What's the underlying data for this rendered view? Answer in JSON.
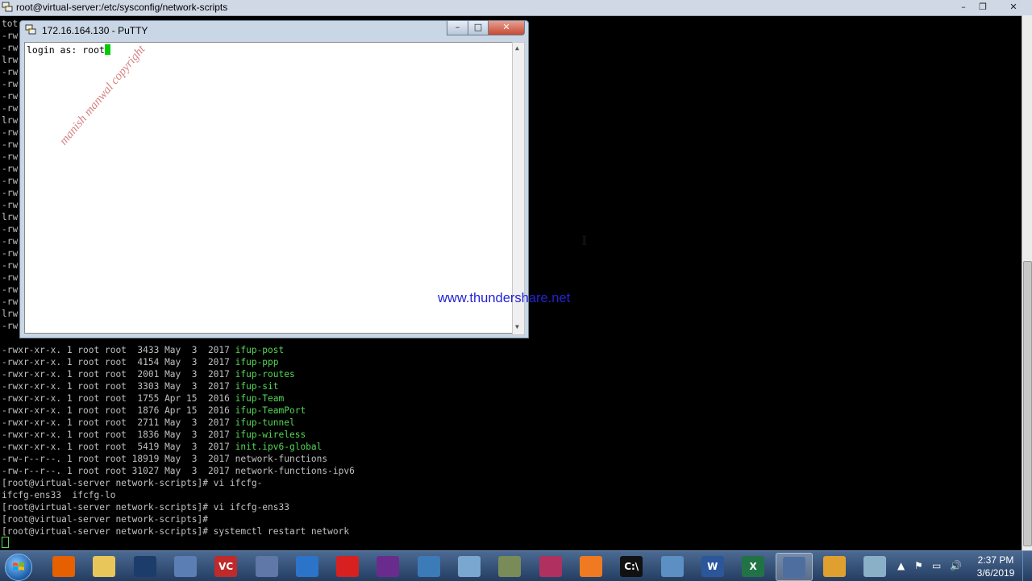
{
  "background_window": {
    "title": "root@virtual-server:/etc/sysconfig/network-scripts",
    "controls": {
      "minimize": "–",
      "maximize": "❐",
      "close": "✕"
    },
    "left_fragments": [
      "tot",
      "-rw",
      "-rw",
      "lrw",
      "-rw",
      "-rw",
      "-rw",
      "-rw",
      "lrw",
      "-rw",
      "-rw",
      "-rw",
      "-rw",
      "-rw",
      "-rw",
      "-rw",
      "lrw",
      "-rw",
      "-rw",
      "-rw",
      "-rw",
      "-rw",
      "-rw",
      "-rw",
      "lrw",
      "-rw"
    ],
    "listing": [
      {
        "info": "-rwxr-xr-x. 1 root root  3433 May  3  2017 ",
        "name": "ifup-post",
        "exec": true
      },
      {
        "info": "-rwxr-xr-x. 1 root root  4154 May  3  2017 ",
        "name": "ifup-ppp",
        "exec": true
      },
      {
        "info": "-rwxr-xr-x. 1 root root  2001 May  3  2017 ",
        "name": "ifup-routes",
        "exec": true
      },
      {
        "info": "-rwxr-xr-x. 1 root root  3303 May  3  2017 ",
        "name": "ifup-sit",
        "exec": true
      },
      {
        "info": "-rwxr-xr-x. 1 root root  1755 Apr 15  2016 ",
        "name": "ifup-Team",
        "exec": true
      },
      {
        "info": "-rwxr-xr-x. 1 root root  1876 Apr 15  2016 ",
        "name": "ifup-TeamPort",
        "exec": true
      },
      {
        "info": "-rwxr-xr-x. 1 root root  2711 May  3  2017 ",
        "name": "ifup-tunnel",
        "exec": true
      },
      {
        "info": "-rwxr-xr-x. 1 root root  1836 May  3  2017 ",
        "name": "ifup-wireless",
        "exec": true
      },
      {
        "info": "-rwxr-xr-x. 1 root root  5419 May  3  2017 ",
        "name": "init.ipv6-global",
        "exec": true
      },
      {
        "info": "-rw-r--r--. 1 root root 18919 May  3  2017 ",
        "name": "network-functions",
        "exec": false
      },
      {
        "info": "-rw-r--r--. 1 root root 31027 May  3  2017 ",
        "name": "network-functions-ipv6",
        "exec": false
      }
    ],
    "commands": [
      "[root@virtual-server network-scripts]# vi ifcfg-",
      "ifcfg-ens33  ifcfg-lo",
      "[root@virtual-server network-scripts]# vi ifcfg-ens33",
      "[root@virtual-server network-scripts]#",
      "[root@virtual-server network-scripts]# systemctl restart network"
    ]
  },
  "putty_window": {
    "title": "172.16.164.130 - PuTTY",
    "controls": {
      "minimize": "–",
      "maximize": "□",
      "close": "✕"
    },
    "terminal_text": "login as: root",
    "watermark": "manish manwal copyright"
  },
  "overlay_url": "www.thundershare.net",
  "mouse_cursor": "I",
  "taskbar": {
    "apps": [
      {
        "name": "firefox",
        "glyph": "",
        "color": "#e66000"
      },
      {
        "name": "file-explorer",
        "glyph": "",
        "color": "#e8c65a"
      },
      {
        "name": "terminal-window",
        "glyph": "",
        "color": "#1c3d6b"
      },
      {
        "name": "network-tool",
        "glyph": "",
        "color": "#5b7fb5"
      },
      {
        "name": "vc",
        "glyph": "VC",
        "color": "#c02a2a"
      },
      {
        "name": "putty-connect",
        "glyph": "",
        "color": "#5f78a8"
      },
      {
        "name": "wireshark",
        "glyph": "",
        "color": "#2c74c9"
      },
      {
        "name": "record",
        "glyph": "",
        "color": "#d82020"
      },
      {
        "name": "stock-chart",
        "glyph": "",
        "color": "#6a2c8c"
      },
      {
        "name": "calc-tools",
        "glyph": "",
        "color": "#3c7bb8"
      },
      {
        "name": "eye-viewer",
        "glyph": "",
        "color": "#7aa7d0"
      },
      {
        "name": "game-controller",
        "glyph": "",
        "color": "#7a8b5a"
      },
      {
        "name": "molecule",
        "glyph": "",
        "color": "#b03060"
      },
      {
        "name": "xampp",
        "glyph": "",
        "color": "#f07a22"
      },
      {
        "name": "cmd",
        "glyph": "C:\\",
        "color": "#111111"
      },
      {
        "name": "network-map",
        "glyph": "",
        "color": "#5c8fc4"
      },
      {
        "name": "word",
        "glyph": "W",
        "color": "#2b579a"
      },
      {
        "name": "excel",
        "glyph": "X",
        "color": "#217346"
      },
      {
        "name": "putty",
        "glyph": "",
        "color": "#4f6ea0"
      },
      {
        "name": "vmware",
        "glyph": "",
        "color": "#e0a030"
      },
      {
        "name": "eraser",
        "glyph": "",
        "color": "#8ab0c8"
      }
    ],
    "active_index": 18,
    "tray": {
      "up_arrow": "▲",
      "flag": "⚑",
      "network": "▭",
      "volume": "🔊"
    },
    "time": "2:37 PM",
    "date": "3/6/2019"
  }
}
